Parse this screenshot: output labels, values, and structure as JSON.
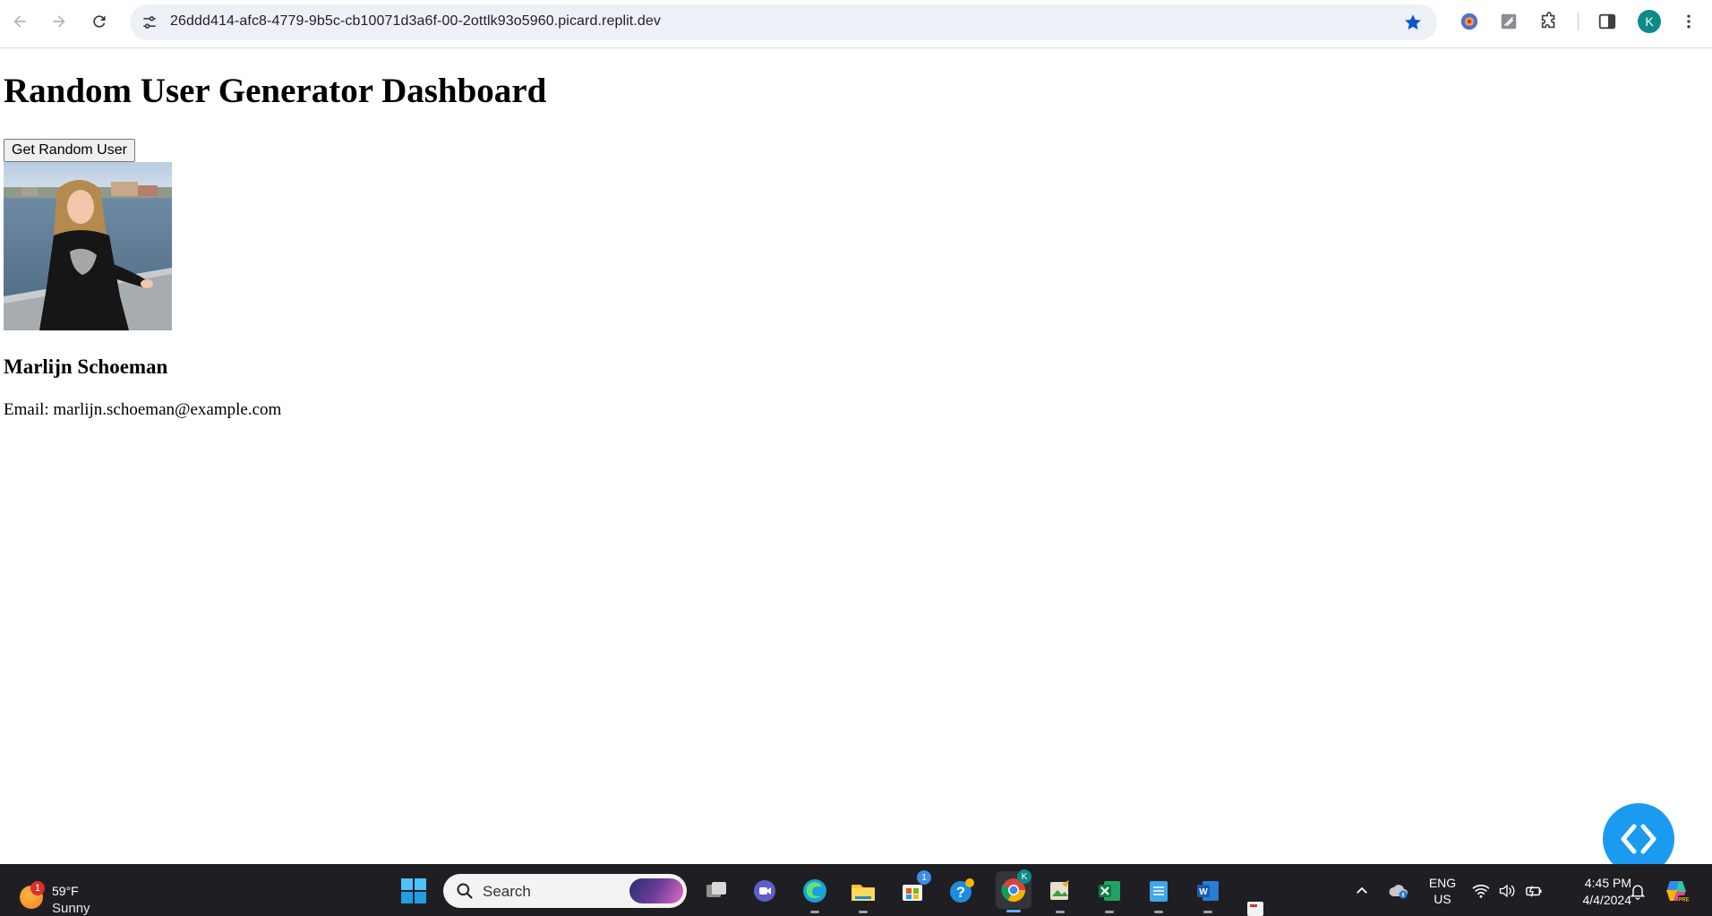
{
  "browser": {
    "url": "26ddd414-afc8-4779-9b5c-cb10071d3a6f-00-2ottlk93o5960.picard.replit.dev",
    "profile_initial": "K"
  },
  "page": {
    "title": "Random User Generator Dashboard",
    "button_label": "Get Random User",
    "user": {
      "name": "Marlijn Schoeman",
      "email_line": "Email: marlijn.schoeman@example.com"
    }
  },
  "taskbar": {
    "weather": {
      "temp": "59°F",
      "condition": "Sunny",
      "badge": "1"
    },
    "search_label": "Search",
    "store_badge": "1",
    "chrome_badge": "K",
    "language": {
      "line1": "ENG",
      "line2": "US"
    },
    "clock": {
      "time": "4:45 PM",
      "date": "4/4/2024"
    }
  },
  "colors": {
    "accent_blue": "#1a9bf0",
    "star_blue": "#0b57d0",
    "taskbar_bg": "#1f1f23"
  }
}
